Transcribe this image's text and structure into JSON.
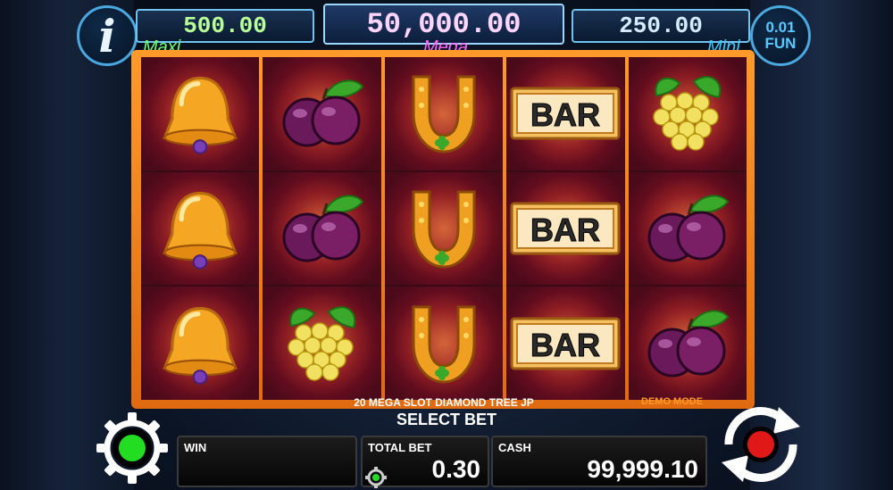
{
  "jackpots": {
    "maxi": {
      "label": "Maxi",
      "value": "500.00"
    },
    "mega": {
      "label": "Mega",
      "value": "50,000.00"
    },
    "mini": {
      "label": "Mini",
      "value": "250.00"
    }
  },
  "info_button": {
    "glyph": "i",
    "icon": "info-icon"
  },
  "currency": {
    "denomination": "0.01",
    "mode": "FUN"
  },
  "reels": [
    [
      "bell",
      "bell",
      "bell"
    ],
    [
      "plum",
      "plum",
      "grapes"
    ],
    [
      "horseshoe",
      "horseshoe",
      "horseshoe"
    ],
    [
      "bar",
      "bar",
      "bar"
    ],
    [
      "grapes",
      "plum",
      "plum"
    ]
  ],
  "game_title": "20 MEGA SLOT DIAMOND TREE JP",
  "demo_mode": "DEMO MODE",
  "select_bet": "SELECT BET",
  "panels": {
    "win": {
      "label": "WIN",
      "value": ""
    },
    "total_bet": {
      "label": "TOTAL BET",
      "value": "0.30"
    },
    "cash": {
      "label": "CASH",
      "value": "99,999.10"
    }
  },
  "bar_text": "BAR",
  "colors": {
    "frame": "#ff9a2a",
    "maxi": "#70ff70",
    "mega": "#ff66ff",
    "mini": "#40c8ff",
    "demo": "#ff9a2a"
  }
}
